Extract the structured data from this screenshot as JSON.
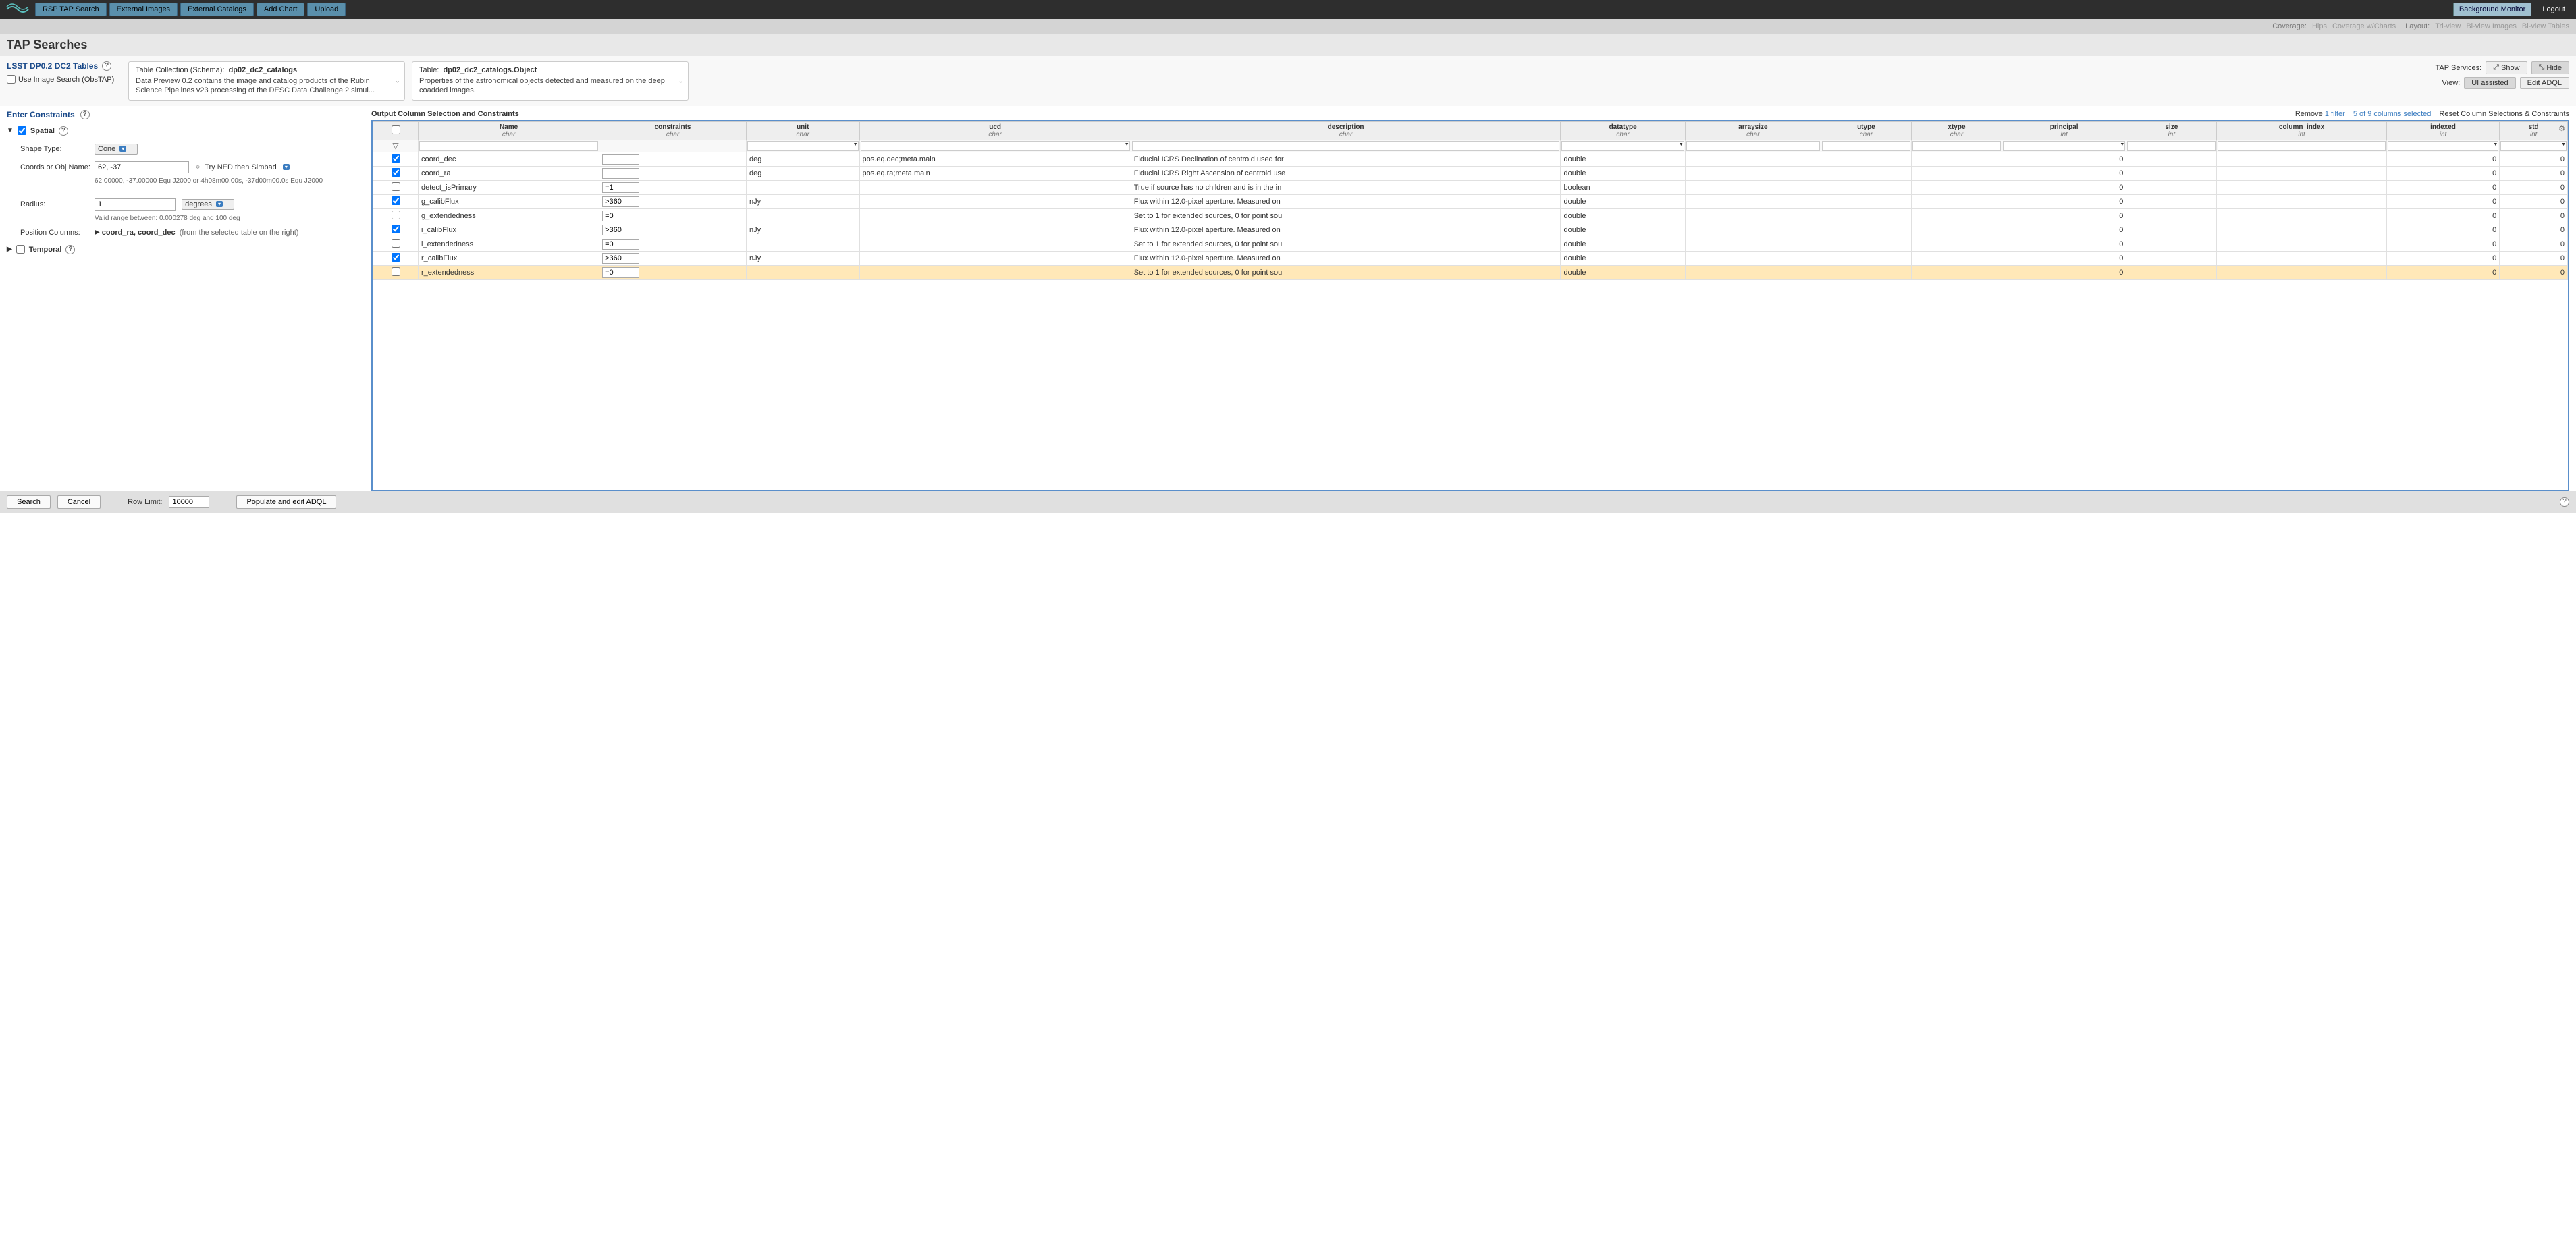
{
  "topbar": {
    "buttons": [
      "RSP TAP Search",
      "External Images",
      "External Catalogs",
      "Add Chart",
      "Upload"
    ],
    "bg_monitor": "Background Monitor",
    "logout": "Logout"
  },
  "secbar": {
    "coverage_label": "Coverage:",
    "coverage_opts": [
      "Hips",
      "Coverage w/Charts"
    ],
    "layout_label": "Layout:",
    "layout_opts": [
      "Tri-view",
      "Bi-view Images",
      "Bi-view Tables"
    ]
  },
  "page_title": "TAP Searches",
  "tables": {
    "title": "LSST DP0.2 DC2 Tables",
    "obs_tap": "Use Image Search (ObsTAP)"
  },
  "schema_box": {
    "label": "Table Collection (Schema):",
    "name": "dp02_dc2_catalogs",
    "desc": "Data Preview 0.2 contains the image and catalog products of the Rubin Science Pipelines v23 processing of the DESC Data Challenge 2 simul..."
  },
  "table_box": {
    "label": "Table:",
    "name": "dp02_dc2_catalogs.Object",
    "desc": "Properties of the astronomical objects detected and measured on the deep coadded images."
  },
  "services": {
    "label": "TAP Services:",
    "show": "Show",
    "hide": "Hide",
    "view_label": "View:",
    "ui": "UI assisted",
    "adql": "Edit ADQL"
  },
  "constraints_title": "Enter Constraints",
  "spatial": {
    "label": "Spatial",
    "shape_label": "Shape Type:",
    "shape_val": "Cone",
    "coords_label": "Coords or Obj Name:",
    "coords_val": "62, -37",
    "try_label": "Try NED then Simbad",
    "coords_hint": "62.00000, -37.00000  Equ J2000   or   4h08m00.00s, -37d00m00.0s  Equ J2000",
    "radius_label": "Radius:",
    "radius_val": "1",
    "radius_unit": "degrees",
    "radius_hint": "Valid range between: 0.000278 deg and 100 deg",
    "pos_label": "Position Columns:",
    "pos_val": "coord_ra, coord_dec",
    "pos_hint": "(from the selected table on the right)"
  },
  "temporal_label": "Temporal",
  "right_head": {
    "title": "Output Column Selection and Constraints",
    "remove": "Remove",
    "remove_n": "1 filter",
    "cols": "5 of 9 columns selected",
    "reset": "Reset Column Selections & Constraints"
  },
  "columns": [
    "Name",
    "constraints",
    "unit",
    "ucd",
    "description",
    "datatype",
    "arraysize",
    "utype",
    "xtype",
    "principal",
    "size",
    "column_index",
    "indexed",
    "std"
  ],
  "col_types": [
    "char",
    "char",
    "char",
    "char",
    "char",
    "char",
    "char",
    "char",
    "char",
    "int",
    "int",
    "int",
    "int",
    "int"
  ],
  "rows": [
    {
      "chk": true,
      "name": "coord_dec",
      "constraint": "",
      "unit": "deg",
      "ucd": "pos.eq.dec;meta.main",
      "desc": "Fiducial ICRS Declination of centroid used for",
      "dtype": "double",
      "principal": "0",
      "indexed": "0",
      "std": "0"
    },
    {
      "chk": true,
      "name": "coord_ra",
      "constraint": "",
      "unit": "deg",
      "ucd": "pos.eq.ra;meta.main",
      "desc": "Fiducial ICRS Right Ascension of centroid use",
      "dtype": "double",
      "principal": "0",
      "indexed": "0",
      "std": "0"
    },
    {
      "chk": false,
      "name": "detect_isPrimary",
      "constraint": "=1",
      "unit": "",
      "ucd": "",
      "desc": "True if source has no children and is in the in",
      "dtype": "boolean",
      "principal": "0",
      "indexed": "0",
      "std": "0"
    },
    {
      "chk": true,
      "name": "g_calibFlux",
      "constraint": ">360",
      "unit": "nJy",
      "ucd": "",
      "desc": "Flux within 12.0-pixel aperture. Measured on",
      "dtype": "double",
      "principal": "0",
      "indexed": "0",
      "std": "0"
    },
    {
      "chk": false,
      "name": "g_extendedness",
      "constraint": "=0",
      "unit": "",
      "ucd": "",
      "desc": "Set to 1 for extended sources, 0 for point sou",
      "dtype": "double",
      "principal": "0",
      "indexed": "0",
      "std": "0"
    },
    {
      "chk": true,
      "name": "i_calibFlux",
      "constraint": ">360",
      "unit": "nJy",
      "ucd": "",
      "desc": "Flux within 12.0-pixel aperture. Measured on",
      "dtype": "double",
      "principal": "0",
      "indexed": "0",
      "std": "0"
    },
    {
      "chk": false,
      "name": "i_extendedness",
      "constraint": "=0",
      "unit": "",
      "ucd": "",
      "desc": "Set to 1 for extended sources, 0 for point sou",
      "dtype": "double",
      "principal": "0",
      "indexed": "0",
      "std": "0"
    },
    {
      "chk": true,
      "name": "r_calibFlux",
      "constraint": ">360",
      "unit": "nJy",
      "ucd": "",
      "desc": "Flux within 12.0-pixel aperture. Measured on",
      "dtype": "double",
      "principal": "0",
      "indexed": "0",
      "std": "0"
    },
    {
      "chk": false,
      "name": "r_extendedness",
      "constraint": "=0",
      "unit": "",
      "ucd": "",
      "desc": "Set to 1 for extended sources, 0 for point sou",
      "dtype": "double",
      "principal": "0",
      "indexed": "0",
      "std": "0",
      "sel": true
    }
  ],
  "footer": {
    "search": "Search",
    "cancel": "Cancel",
    "rowlimit_label": "Row Limit:",
    "rowlimit_val": "10000",
    "populate": "Populate and edit ADQL"
  }
}
